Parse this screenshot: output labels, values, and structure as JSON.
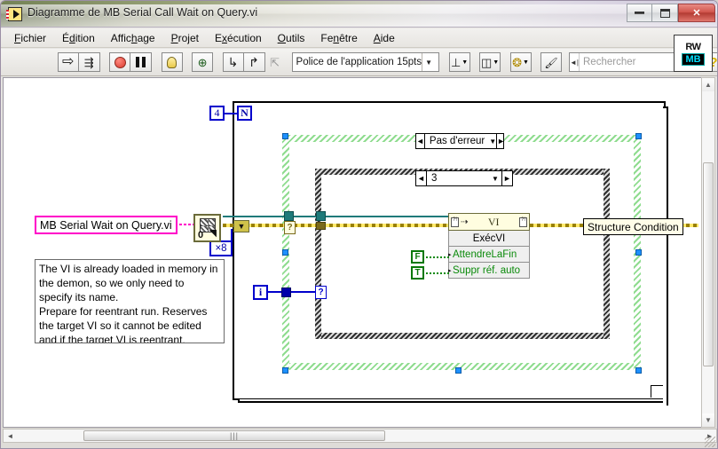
{
  "window": {
    "title": "Diagramme de MB Serial Call Wait on Query.vi",
    "app_icon": "labview-vi-icon",
    "controls": {
      "minimize": "–",
      "maximize": "❐",
      "close": "✕"
    }
  },
  "menubar": {
    "items": [
      {
        "label": "Fichier",
        "accel": "F"
      },
      {
        "label": "Édition",
        "accel": "d"
      },
      {
        "label": "Affichage",
        "accel": "h"
      },
      {
        "label": "Projet",
        "accel": "P"
      },
      {
        "label": "Exécution",
        "accel": "x"
      },
      {
        "label": "Outils",
        "accel": "O"
      },
      {
        "label": "Fenêtre",
        "accel": "n"
      },
      {
        "label": "Aide",
        "accel": "A"
      }
    ]
  },
  "toolbar": {
    "buttons": [
      {
        "name": "run-button",
        "icon": "run-arrow-icon"
      },
      {
        "name": "run-continuously-button",
        "icon": "run-continuously-icon"
      },
      {
        "name": "abort-execution-button",
        "icon": "abort-stop-icon"
      },
      {
        "name": "pause-button",
        "icon": "pause-icon"
      },
      {
        "name": "highlight-execution-button",
        "icon": "light-bulb-icon"
      },
      {
        "name": "retain-wire-values-button",
        "icon": "probe-retain-icon"
      },
      {
        "name": "step-into-button",
        "icon": "step-into-icon"
      },
      {
        "name": "step-over-button",
        "icon": "step-over-icon"
      },
      {
        "name": "step-out-button",
        "icon": "step-out-icon"
      }
    ],
    "font_selector": {
      "value": "Police de l'application 15pts",
      "caret": "▼"
    },
    "align_objects": {
      "icon": "align-objects-icon",
      "caret": "▼"
    },
    "distribute_objects": {
      "icon": "distribute-objects-icon",
      "caret": "▼"
    },
    "reorder": {
      "icon": "reorder-icon",
      "caret": "▼"
    },
    "clean_diagram": {
      "icon": "clean-up-diagram-icon"
    },
    "search": {
      "placeholder": "Rechercher",
      "value": "",
      "icon": "magnifier-icon",
      "prefix": "◄|"
    },
    "help": {
      "label": "?",
      "name": "context-help-button"
    }
  },
  "branding": {
    "top": "RW",
    "bottom": "MB"
  },
  "diagram": {
    "loop_count_constant": "4",
    "loop_count_terminal": "N",
    "iteration_terminal": "i",
    "case_outer": {
      "label": "Pas d'erreur",
      "left_arrow": "◄",
      "right_arrow": "►",
      "caret": "▼"
    },
    "case_inner": {
      "label": "3",
      "left_arrow": "◄",
      "right_arrow": "►",
      "caret": "▼"
    },
    "vi_node": {
      "header": "VI",
      "rows": [
        "ExécVI",
        "AttendreLaFin",
        "Suppr réf. auto"
      ]
    },
    "bool_constants": [
      {
        "label": "F",
        "name": "false-constant"
      },
      {
        "label": "T",
        "name": "true-constant"
      }
    ],
    "string_constant": "MB Serial Wait on Query.vi",
    "numeric_constant": "×8",
    "open_vi_reference": {
      "index": "0",
      "icon": "open-vi-reference-icon"
    },
    "case_selector_glyph": "?",
    "comment": "The VI is already loaded in memory in the demon, so we only need to specify its name.\nPrepare for reentrant run. Reserves the target VI so it cannot be edited and if the target VI is reentrant, allocates a dedicated parallel data space for this",
    "tooltip": "Structure Condition"
  },
  "scrollbars": {
    "vertical": {
      "up": "▲",
      "down": "▼"
    },
    "horizontal": {
      "left": "◄",
      "right": "►",
      "grip": "|||"
    }
  },
  "colors": {
    "error_wire": "#998000",
    "selection_handle": "#1e90ff",
    "selected_structure": "#8fdc8f",
    "string_constant_border": "#ff00c8",
    "numeric_blue": "#0000cc",
    "boolean_green": "#087808",
    "vi_node_bg": "#fffde0"
  }
}
